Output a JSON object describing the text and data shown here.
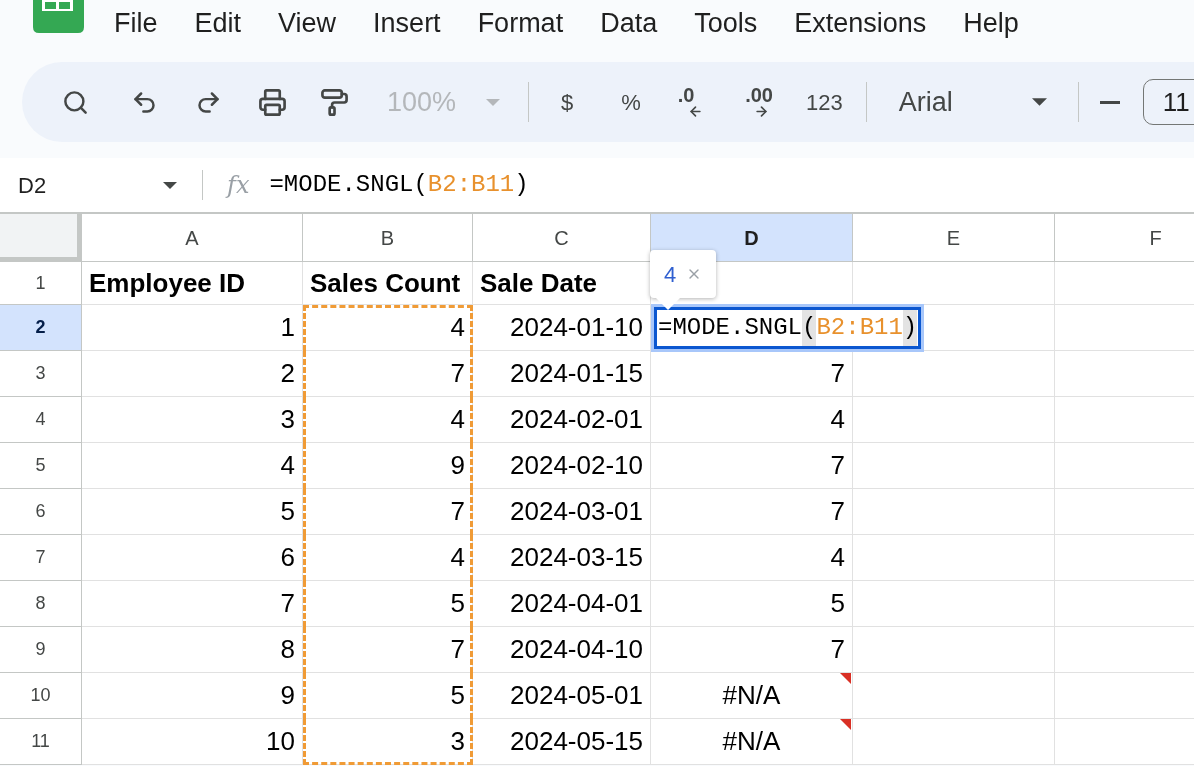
{
  "menu_bar": {
    "items": [
      "File",
      "Edit",
      "View",
      "Insert",
      "Format",
      "Data",
      "Tools",
      "Extensions",
      "Help"
    ]
  },
  "toolbar": {
    "zoom": {
      "value": "100%",
      "disabled": true
    },
    "number_formats": [
      {
        "kind": "text",
        "label": "$"
      },
      {
        "kind": "text",
        "label": "%"
      },
      {
        "kind": "decrease_decimal",
        "label": ".0"
      },
      {
        "kind": "increase_decimal",
        "label": ".00"
      },
      {
        "kind": "text",
        "label": "123"
      }
    ],
    "font": {
      "value": "Arial"
    },
    "font_size": {
      "value": "11"
    }
  },
  "formula_bar": {
    "name_box": "D2",
    "function_label": "fx",
    "tokens": [
      {
        "kind": "plain",
        "text": "=MODE.SNGL("
      },
      {
        "kind": "range",
        "text": "B2:B11"
      },
      {
        "kind": "plain",
        "text": ")"
      }
    ]
  },
  "sheet": {
    "columns": [
      {
        "label": "A",
        "selected": false
      },
      {
        "label": "B",
        "selected": false
      },
      {
        "label": "C",
        "selected": false
      },
      {
        "label": "D",
        "selected": true
      },
      {
        "label": "E",
        "selected": false
      },
      {
        "label": "F",
        "selected": false
      }
    ],
    "rows": [
      {
        "label": "1",
        "selected": false,
        "cells": [
          {
            "kind": "header",
            "text": "Employee ID",
            "in_range": false
          },
          {
            "kind": "header",
            "text": "Sales Count",
            "in_range": false
          },
          {
            "kind": "header",
            "text": "Sale Date",
            "in_range": false
          }
        ]
      },
      {
        "label": "2",
        "selected": true,
        "cells": [
          {
            "kind": "number",
            "text": "1",
            "in_range": false
          },
          {
            "kind": "number",
            "text": "4",
            "in_range": true
          },
          {
            "kind": "number",
            "text": "2024-01-10",
            "in_range": false
          },
          {
            "kind": "editing",
            "preview": "4",
            "tokens": [
              {
                "kind": "plain",
                "text": "=MODE.SNGL"
              },
              {
                "kind": "paren",
                "text": "("
              },
              {
                "kind": "range",
                "text": "B2:B11"
              },
              {
                "kind": "paren",
                "text": ")"
              }
            ]
          }
        ]
      },
      {
        "label": "3",
        "selected": false,
        "cells": [
          {
            "kind": "number",
            "text": "2",
            "in_range": false
          },
          {
            "kind": "number",
            "text": "7",
            "in_range": true
          },
          {
            "kind": "number",
            "text": "2024-01-15",
            "in_range": false
          },
          {
            "kind": "number",
            "text": "7",
            "in_range": false
          }
        ]
      },
      {
        "label": "4",
        "selected": false,
        "cells": [
          {
            "kind": "number",
            "text": "3",
            "in_range": false
          },
          {
            "kind": "number",
            "text": "4",
            "in_range": true
          },
          {
            "kind": "number",
            "text": "2024-02-01",
            "in_range": false
          },
          {
            "kind": "number",
            "text": "4",
            "in_range": false
          }
        ]
      },
      {
        "label": "5",
        "selected": false,
        "cells": [
          {
            "kind": "number",
            "text": "4",
            "in_range": false
          },
          {
            "kind": "number",
            "text": "9",
            "in_range": true
          },
          {
            "kind": "number",
            "text": "2024-02-10",
            "in_range": false
          },
          {
            "kind": "number",
            "text": "7",
            "in_range": false
          }
        ]
      },
      {
        "label": "6",
        "selected": false,
        "cells": [
          {
            "kind": "number",
            "text": "5",
            "in_range": false
          },
          {
            "kind": "number",
            "text": "7",
            "in_range": true
          },
          {
            "kind": "number",
            "text": "2024-03-01",
            "in_range": false
          },
          {
            "kind": "number",
            "text": "7",
            "in_range": false
          }
        ]
      },
      {
        "label": "7",
        "selected": false,
        "cells": [
          {
            "kind": "number",
            "text": "6",
            "in_range": false
          },
          {
            "kind": "number",
            "text": "4",
            "in_range": true
          },
          {
            "kind": "number",
            "text": "2024-03-15",
            "in_range": false
          },
          {
            "kind": "number",
            "text": "4",
            "in_range": false
          }
        ]
      },
      {
        "label": "8",
        "selected": false,
        "cells": [
          {
            "kind": "number",
            "text": "7",
            "in_range": false
          },
          {
            "kind": "number",
            "text": "5",
            "in_range": true
          },
          {
            "kind": "number",
            "text": "2024-04-01",
            "in_range": false
          },
          {
            "kind": "number",
            "text": "5",
            "in_range": false
          }
        ]
      },
      {
        "label": "9",
        "selected": false,
        "cells": [
          {
            "kind": "number",
            "text": "8",
            "in_range": false
          },
          {
            "kind": "number",
            "text": "7",
            "in_range": true
          },
          {
            "kind": "number",
            "text": "2024-04-10",
            "in_range": false
          },
          {
            "kind": "number",
            "text": "7",
            "in_range": false
          }
        ]
      },
      {
        "label": "10",
        "selected": false,
        "cells": [
          {
            "kind": "number",
            "text": "9",
            "in_range": false
          },
          {
            "kind": "number",
            "text": "5",
            "in_range": true
          },
          {
            "kind": "number",
            "text": "2024-05-01",
            "in_range": false
          },
          {
            "kind": "error",
            "text": "#N/A",
            "in_range": false
          }
        ]
      },
      {
        "label": "11",
        "selected": false,
        "cells": [
          {
            "kind": "number",
            "text": "10",
            "in_range": false
          },
          {
            "kind": "number",
            "text": "3",
            "in_range": true
          },
          {
            "kind": "number",
            "text": "2024-05-15",
            "in_range": false
          },
          {
            "kind": "error",
            "text": "#N/A",
            "in_range": false
          }
        ]
      }
    ]
  }
}
